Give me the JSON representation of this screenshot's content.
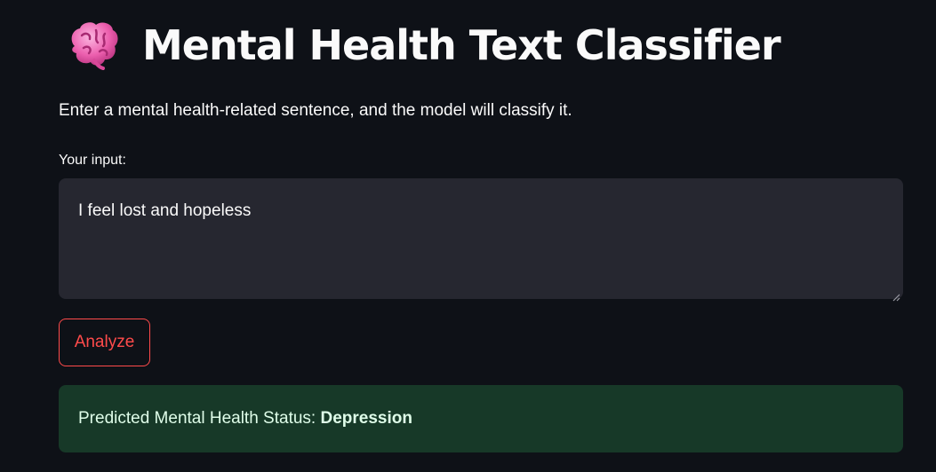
{
  "header": {
    "icon": "brain-icon",
    "title": "Mental Health Text Classifier"
  },
  "subtitle": "Enter a mental health-related sentence, and the model will classify it.",
  "form": {
    "input_label": "Your input:",
    "input_value": "I feel lost and hopeless",
    "button_label": "Analyze"
  },
  "result": {
    "prefix": "Predicted Mental Health Status: ",
    "value": "Depression"
  },
  "colors": {
    "background": "#0e1117",
    "input_background": "#262730",
    "accent": "#ff4b4b",
    "success_background": "#173928",
    "brain": "#f472b6"
  }
}
